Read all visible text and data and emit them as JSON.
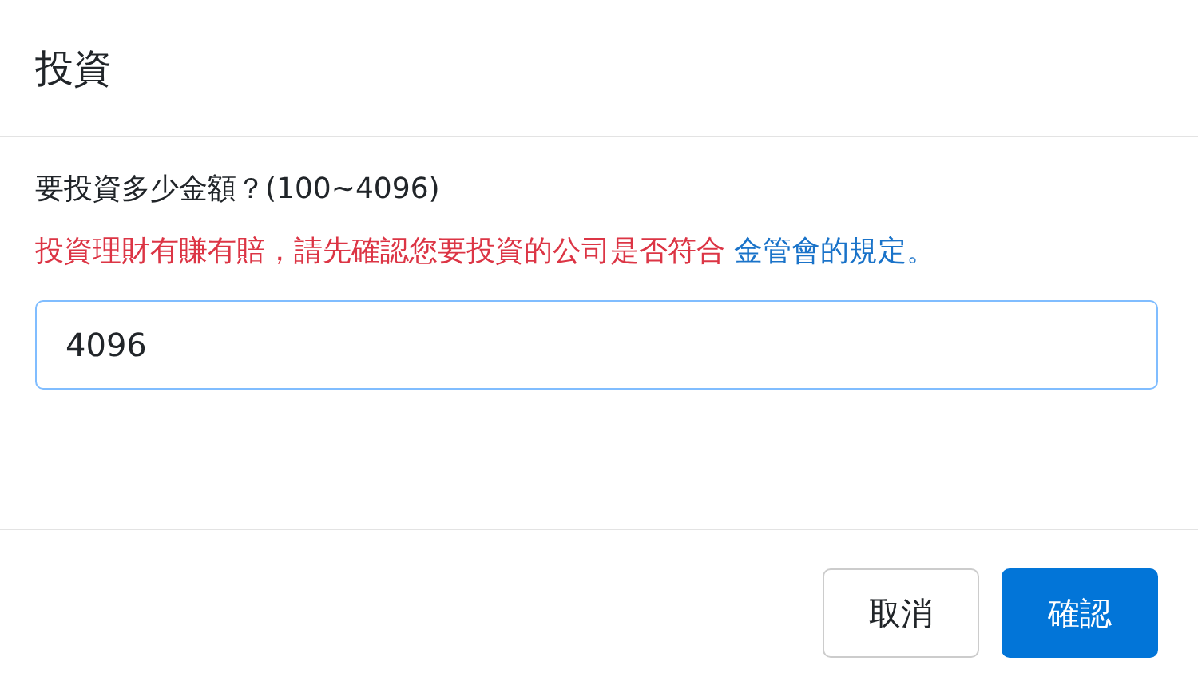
{
  "dialog": {
    "title": "投資"
  },
  "prompt": "要投資多少金額？(100~4096)",
  "warning": {
    "text": "投資理財有賺有賠，請先確認您要投資的公司是否符合 ",
    "highlight": "金管會的規定。"
  },
  "amount_field": {
    "value": "4096"
  },
  "buttons": [
    {
      "label": "取消",
      "kind": "secondary"
    },
    {
      "label": "確認",
      "kind": "primary"
    }
  ]
}
